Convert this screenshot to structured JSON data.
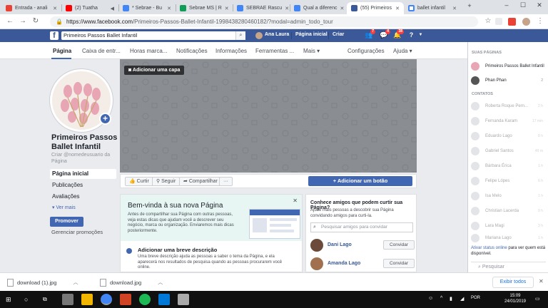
{
  "browser": {
    "tabs": [
      {
        "title": "Entrada - anali",
        "color": "#ea4335"
      },
      {
        "title": "(2) Tuatha",
        "color": "#ff0000"
      },
      {
        "title": "* Sebrae - Bu",
        "color": "#4285f4"
      },
      {
        "title": "Sebrae MS | R",
        "color": "#0f9d58"
      },
      {
        "title": "SEBRAE Rascu",
        "color": "#4285f4"
      },
      {
        "title": "Qual a diferenc",
        "color": "#4285f4"
      },
      {
        "title": "(55) Primeiros",
        "color": "#3b5998"
      },
      {
        "title": "ballet infantil",
        "color": "#4285f4"
      }
    ],
    "url_host": "https://www.facebook.com",
    "url_path": "/Primeiros-Passos-Ballet-Infantil-1998438280460182/?modal=admin_todo_tour"
  },
  "fb_header": {
    "search_value": "Primeiros Passos Ballet Infantil",
    "user": "Ana Laura",
    "home": "Página inicial",
    "create": "Criar",
    "friend_badge": "7",
    "msg_badge": "4",
    "notif_badge": "38"
  },
  "page_nav": {
    "items": [
      "Página",
      "Caixa de entr...",
      "Horas marca...",
      "Notificações",
      "Informações",
      "Ferramentas ...",
      "Mais ▾",
      "Configurações",
      "Ajuda ▾"
    ]
  },
  "left": {
    "page_name": "Primeiros Passos Ballet Infantil",
    "username": "Criar @nomedeusuario da Página",
    "menu": [
      "Página inicial",
      "Publicações",
      "Avaliações"
    ],
    "see_more": "▾ Ver mais",
    "promote": "Promover",
    "manage_promotions": "Gerenciar promoções"
  },
  "cover": {
    "add_cover": "Adicionar uma capa"
  },
  "actions": {
    "like": "Curtir",
    "follow": "Seguir",
    "share": "Compartilhar",
    "more": "···",
    "add_button": "+ Adicionar um botão"
  },
  "welcome": {
    "title": "Bem-vinda à sua nova Página",
    "desc": "Antes de compartilhar sua Página com outras pessoas, veja estas dicas que ajudam você a descrever seu negócio, marca ou organização. Enviaremos mais dicas posteriormente.",
    "close": "✕",
    "step_title": "Adicionar uma breve descrição",
    "step_text": "Uma breve descrição ajuda as pessoas a saber o tema da Página, e ela aparecerá nos resultados de pesquisa quando as pessoas procurarem você online."
  },
  "invite": {
    "title": "Conhece amigos que podem curtir sua Página?",
    "desc": "Ajude mais pessoas a descobrir sua Página convidando amigos para curti-la.",
    "search_placeholder": "Pesquisar amigos para convidar",
    "friends": [
      {
        "name": "Dani Lago",
        "button": "Convidar",
        "color": "#6b4a3a"
      },
      {
        "name": "Amanda Lago",
        "button": "Convidar",
        "color": "#a0704f"
      }
    ]
  },
  "chat": {
    "pages_title": "SUAS PÁGINAS",
    "pages": [
      {
        "name": "Primeiros Passos Ballet Infantil",
        "time": ""
      },
      {
        "name": "Phan Phan",
        "time": "2"
      }
    ],
    "contacts_title": "CONTATOS",
    "contacts": [
      {
        "name": "Roberta Roque Pern...",
        "time": "2 h"
      },
      {
        "name": "Fernanda Karam",
        "time": "17 min"
      },
      {
        "name": "Eduardo Lago",
        "time": "8 h"
      },
      {
        "name": "Gabriel Santos",
        "time": "49 m"
      },
      {
        "name": "Bárbara Érica",
        "time": "1 h"
      },
      {
        "name": "Felipe Lópes",
        "time": "6 h"
      },
      {
        "name": "Isa Melo",
        "time": "1 h"
      },
      {
        "name": "Christian Lacerda",
        "time": "9 h"
      },
      {
        "name": "Lara Magi",
        "time": "3 h"
      },
      {
        "name": "Mariana Lago",
        "time": "1 h"
      }
    ],
    "status_link": "Ativar status online",
    "status_rest": "para ver quem está disponível.",
    "search": "Pesquisar"
  },
  "downloads": {
    "items": [
      "download (1).jpg",
      "download.jpg"
    ],
    "show_all": "Exibir todos"
  },
  "taskbar": {
    "time": "15:09",
    "date": "24/01/2019",
    "lang": "POR"
  }
}
